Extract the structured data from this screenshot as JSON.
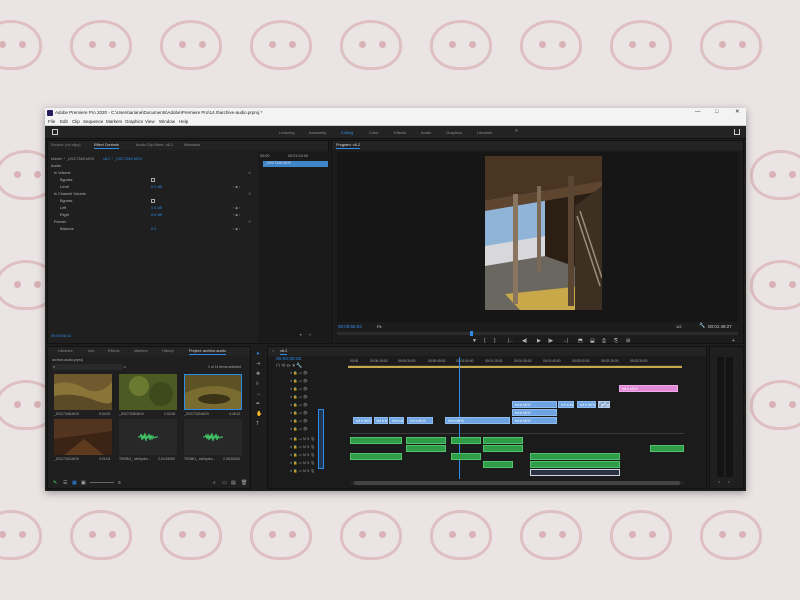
{
  "window": {
    "title": "Adobe Premiere Pro 2020 - C:\\Users\\ariane\\Documents\\Adobe\\Premiere Pro\\14.0\\archive-audio.prproj *",
    "controls": [
      "—",
      "□",
      "✕"
    ]
  },
  "menu": [
    "File",
    "Edit",
    "Clip",
    "Sequence",
    "Markers",
    "Graphics",
    "View",
    "Window",
    "Help"
  ],
  "workspaces": {
    "items": [
      "Learning",
      "Assembly",
      "Editing",
      "Color",
      "Effects",
      "Audio",
      "Graphics",
      "Libraries"
    ],
    "active": "Editing",
    "more": "»"
  },
  "effect_controls": {
    "tabs": [
      "Source: (no clips)",
      "Effect Controls",
      "Audio Clip Mixer: v8-2",
      "Metadata"
    ],
    "active_tab": "Effect Controls",
    "clip_path": "Master * _DSC7346.MOV",
    "clip_name": "v8-2 * _DSC7346.MOV",
    "timecode_start": "00:00",
    "timecode_end": "00:01:04:00",
    "timeline_clip": "_DSC7346.MOV",
    "section": "Audio",
    "rows": [
      {
        "label": "fx Volume",
        "value": ""
      },
      {
        "label": "Bypass",
        "value": ""
      },
      {
        "label": "Level",
        "value": "0.0 dB"
      },
      {
        "label": "fx Channel Volume",
        "value": ""
      },
      {
        "label": "Bypass",
        "value": ""
      },
      {
        "label": "Left",
        "value": "0.0 dB"
      },
      {
        "label": "Right",
        "value": "0.0 dB"
      },
      {
        "label": "Panner",
        "value": ""
      },
      {
        "label": "Balance",
        "value": "0.0"
      }
    ],
    "bottom_timecode": "00:00:46:02"
  },
  "program": {
    "tab": "Program: v8-2",
    "timecode_current": "00:00:56:02",
    "fit": "Fit",
    "quality": "1/2",
    "timecode_total": "00:01:49:27",
    "controls": [
      "▼",
      "{",
      "}",
      "|←",
      "◀|",
      "▶",
      "|▶",
      "→|",
      "⬒",
      "⬓",
      "⎙",
      "⎘",
      "⊞",
      "+"
    ]
  },
  "project": {
    "tabs": [
      "Libraries",
      "Info",
      "Effects",
      "Markers",
      "History",
      "Project: archive-audio"
    ],
    "active_tab": "Project: archive-audio",
    "path": "archive-audio.prproj",
    "items_count": "1 of 14 items selected",
    "items": [
      {
        "name": "_DSC7346.MOV",
        "duration": "5:04:20"
      },
      {
        "name": "_DSC7348.MOV",
        "duration": "2:02:06"
      },
      {
        "name": "_DSC7343.MOV",
        "duration": "4:45:12"
      },
      {
        "name": "_DSC7340.MOV",
        "duration": "0:01:04"
      },
      {
        "name": "TROBO_ sfx/hydro...",
        "duration": "2:24:33000"
      },
      {
        "name": "TROBO_ sfx/hydro...",
        "duration": "2:28:33000"
      }
    ]
  },
  "timeline": {
    "tab": "v8-2",
    "timecode": "00:00:56:02",
    "ruler": [
      "00:00",
      "00:00:15:00",
      "00:00:30:00",
      "00:00:45:00",
      "00:01:00:00",
      "00:01:15:00",
      "00:01:30:00",
      "00:01:45:00",
      "00:02:00:00",
      "00:02:15:00",
      "00:02:30:00"
    ],
    "video_clips": [
      {
        "name": "fx6 b.MOV",
        "track": 4,
        "start": 48.0,
        "end": 58.5,
        "style": "pink"
      },
      {
        "name": "fx3 b.MOV",
        "track": 1,
        "start": 28.9,
        "end": 37.0,
        "style": "v"
      },
      {
        "name": "fx3 b.MOV",
        "track": 2,
        "start": 28.9,
        "end": 37.0,
        "style": "v"
      },
      {
        "name": "fx3 b.MOV",
        "track": 2,
        "start": 37.2,
        "end": 40.0,
        "style": "v"
      },
      {
        "name": "fx3 b.MOV",
        "track": 2,
        "start": 40.5,
        "end": 44.0,
        "style": "v"
      },
      {
        "name": "fx3 b.MOV",
        "track": 2,
        "start": 44.3,
        "end": 46.5,
        "style": "striped"
      },
      {
        "name": "fx3 b.MOV",
        "track": 0,
        "start": 28.9,
        "end": 37.0,
        "style": "v"
      },
      {
        "name": "fx3 b.MOV",
        "track": 0,
        "start": 0.5,
        "end": 4.0,
        "style": "v"
      },
      {
        "name": "fx3 b.MOV",
        "track": 0,
        "start": 4.2,
        "end": 6.8,
        "style": "v"
      },
      {
        "name": "fx3 b.MOV",
        "track": 0,
        "start": 7.0,
        "end": 9.6,
        "style": "v"
      },
      {
        "name": "fx3 b.MOV",
        "track": 0,
        "start": 10.2,
        "end": 14.8,
        "style": "v"
      },
      {
        "name": "fx3 b.MOV",
        "track": 0,
        "start": 17.0,
        "end": 28.5,
        "style": "v"
      }
    ]
  }
}
